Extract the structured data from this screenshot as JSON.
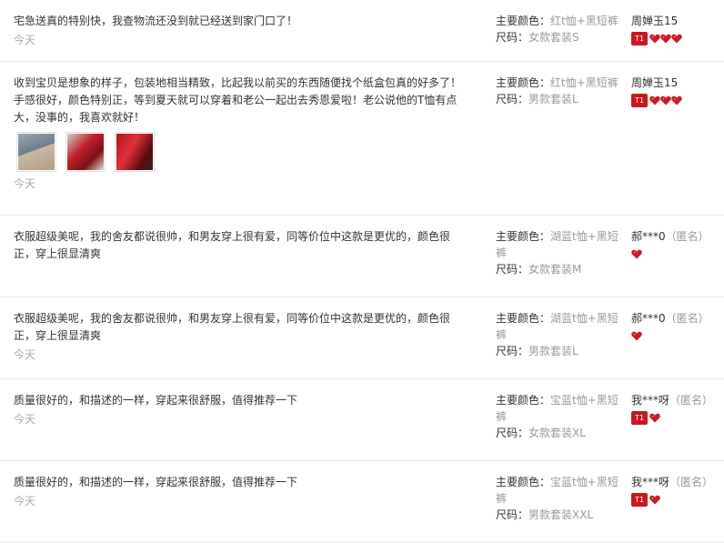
{
  "reviews": [
    {
      "text": "宅急送真的特别快，我查物流还没到就已经送到家门口了！",
      "date": "今天",
      "color_label": "主要颜色：",
      "color_value": "红t恤+黑短裤",
      "size_label": "尺码：",
      "size_value": "女款套装S",
      "user": "周婵玉15",
      "anonymous": "",
      "level_badge": "T1",
      "hearts": 3,
      "photos": []
    },
    {
      "text": "收到宝贝是想象的样子，包装地相当精致，比起我以前买的东西随便找个纸盒包真的好多了！手感很好，颜色特别正，等到夏天就可以穿着和老公一起出去秀恩爱啦！老公说他的T恤有点大，没事的，我喜欢就好！",
      "date": "今天",
      "color_label": "主要颜色：",
      "color_value": "红t恤+黑短裤",
      "size_label": "尺码：",
      "size_value": "男款套装L",
      "user": "周婵玉15",
      "anonymous": "",
      "level_badge": "T1",
      "hearts": 3,
      "photos": [
        "photo-1",
        "photo-2",
        "photo-3"
      ]
    },
    {
      "text": "衣服超级美呢，我的舍友都说很帅，和男友穿上很有爱，同等价位中这款是更优的，颜色很正，穿上很显清爽",
      "date": "",
      "color_label": "主要颜色：",
      "color_value": "湖蓝t恤+黑短裤",
      "size_label": "尺码：",
      "size_value": "女款套装M",
      "user": "郝***0",
      "anonymous": "（匿名）",
      "level_badge": "",
      "hearts": 1,
      "photos": []
    },
    {
      "text": "衣服超级美呢，我的舍友都说很帅，和男友穿上很有爱，同等价位中这款是更优的，颜色很正，穿上很显清爽",
      "date": "今天",
      "color_label": "主要颜色：",
      "color_value": "湖蓝t恤+黑短裤",
      "size_label": "尺码：",
      "size_value": "男款套装L",
      "user": "郝***0",
      "anonymous": "（匿名）",
      "level_badge": "",
      "hearts": 1,
      "photos": []
    },
    {
      "text": "质量很好的，和描述的一样，穿起来很舒服，值得推荐一下",
      "date": "今天",
      "color_label": "主要颜色：",
      "color_value": "宝蓝t恤+黑短裤",
      "size_label": "尺码：",
      "size_value": "女款套装XL",
      "user": "我***呀",
      "anonymous": "（匿名）",
      "level_badge": "T1",
      "hearts": 1,
      "photos": []
    },
    {
      "text": "质量很好的，和描述的一样，穿起来很舒服，值得推荐一下",
      "date": "今天",
      "color_label": "主要颜色：",
      "color_value": "宝蓝t恤+黑短裤",
      "size_label": "尺码：",
      "size_value": "男款套装XXL",
      "user": "我***呀",
      "anonymous": "（匿名）",
      "level_badge": "T1",
      "hearts": 1,
      "photos": []
    }
  ],
  "colors": {
    "heart": "#d0182a",
    "badge": "#c91820",
    "muted": "#999999",
    "divider": "#e8e8e8"
  }
}
